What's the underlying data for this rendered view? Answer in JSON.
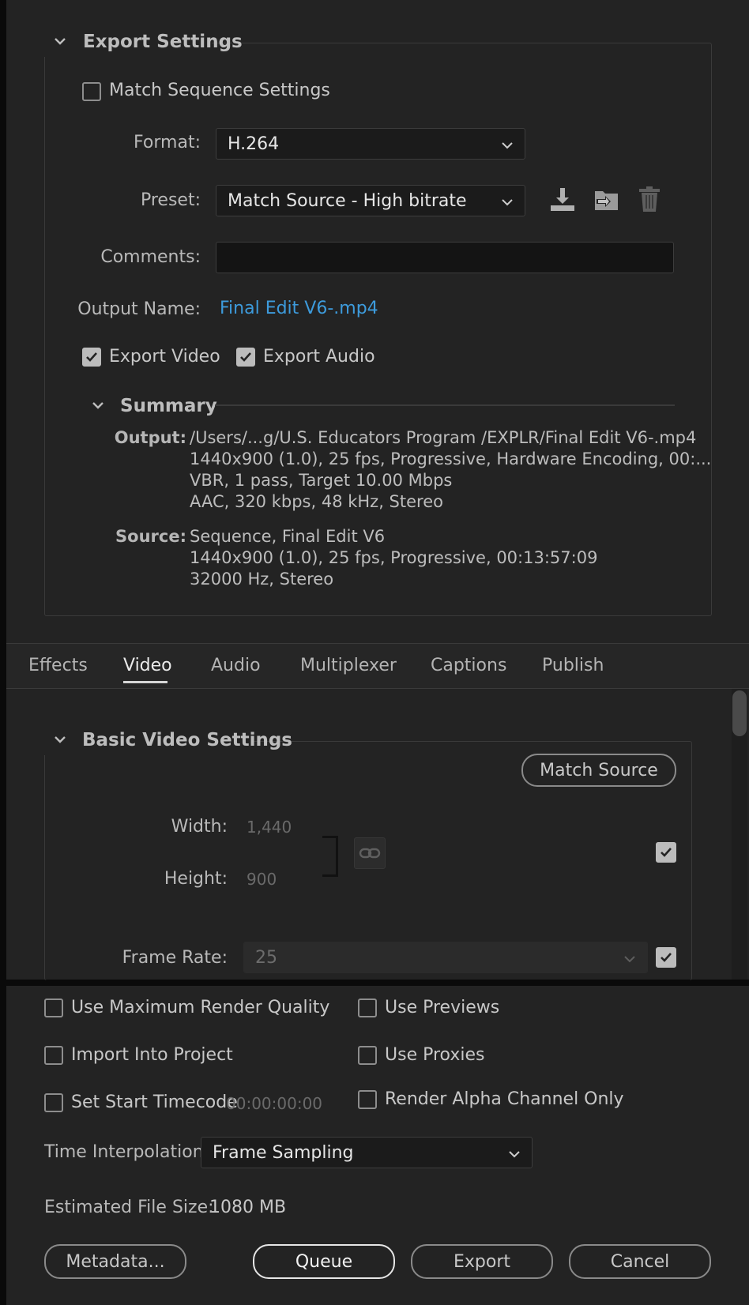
{
  "export_settings": {
    "title": "Export Settings",
    "match_sequence_label": "Match Sequence Settings",
    "format_label": "Format:",
    "format_value": "H.264",
    "preset_label": "Preset:",
    "preset_value": "Match Source - High bitrate",
    "comments_label": "Comments:",
    "comments_value": "",
    "output_name_label": "Output Name:",
    "output_name_value": "Final Edit  V6-.mp4",
    "export_video_label": "Export Video",
    "export_audio_label": "Export Audio",
    "icons": [
      "save-preset-icon",
      "import-preset-icon",
      "delete-preset-icon"
    ]
  },
  "summary": {
    "title": "Summary",
    "output_key": "Output:",
    "output_lines": [
      "/Users/...g/U.S. Educators Program /EXPLR/Final Edit  V6-.mp4",
      "1440x900 (1.0), 25 fps, Progressive, Hardware Encoding, 00:...",
      "VBR, 1 pass, Target 10.00 Mbps",
      "AAC, 320 kbps, 48 kHz, Stereo"
    ],
    "source_key": "Source:",
    "source_lines": [
      "Sequence, Final Edit  V6",
      "1440x900 (1.0), 25 fps, Progressive, 00:13:57:09",
      "32000 Hz, Stereo"
    ]
  },
  "tabs": [
    "Effects",
    "Video",
    "Audio",
    "Multiplexer",
    "Captions",
    "Publish"
  ],
  "active_tab": "Video",
  "video": {
    "section_title": "Basic Video Settings",
    "match_source_label": "Match Source",
    "width_label": "Width:",
    "width_value": "1,440",
    "height_label": "Height:",
    "height_value": "900",
    "frame_rate_label": "Frame Rate:",
    "frame_rate_value": "25"
  },
  "options": {
    "max_render_quality": "Use Maximum Render Quality",
    "use_previews": "Use Previews",
    "import_into_project": "Import Into Project",
    "use_proxies": "Use Proxies",
    "set_start_timecode": "Set Start Timecode",
    "start_timecode_value": "00:00:00:00",
    "render_alpha_only": "Render Alpha Channel Only",
    "time_interpolation_label": "Time Interpolation:",
    "time_interpolation_value": "Frame Sampling",
    "estimated_size_label": "Estimated File Size:",
    "estimated_size_value": "1080 MB"
  },
  "buttons": {
    "metadata": "Metadata...",
    "queue": "Queue",
    "export": "Export",
    "cancel": "Cancel"
  },
  "colors": {
    "background": "#232323",
    "link": "#3d9bdc",
    "field": "#1b1b1b"
  }
}
